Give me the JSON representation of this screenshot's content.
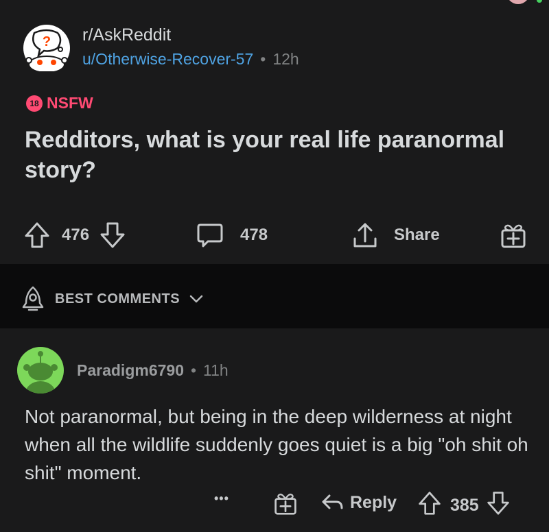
{
  "post": {
    "subreddit": "r/AskReddit",
    "author": "u/Otherwise-Recover-57",
    "separator": "•",
    "age": "12h",
    "nsfw_badge": "18",
    "nsfw_label": "NSFW",
    "title": "Redditors, what is your real life paranormal story?",
    "upvotes": "476",
    "comments": "478",
    "share_label": "Share"
  },
  "sort": {
    "label": "BEST COMMENTS"
  },
  "comment": {
    "author": "Paradigm6790",
    "separator": "•",
    "age": "11h",
    "body": "Not paranormal, but being in the deep wilderness at night when all the wildlife suddenly goes quiet is a big \"oh shit oh shit\" moment.",
    "more": "•••",
    "reply_label": "Reply",
    "score": "385"
  },
  "colors": {
    "background": "#1a1a1b",
    "accent_link": "#4fa3e3",
    "nsfw": "#ff4a73",
    "avatar_green": "#7dd85a"
  }
}
